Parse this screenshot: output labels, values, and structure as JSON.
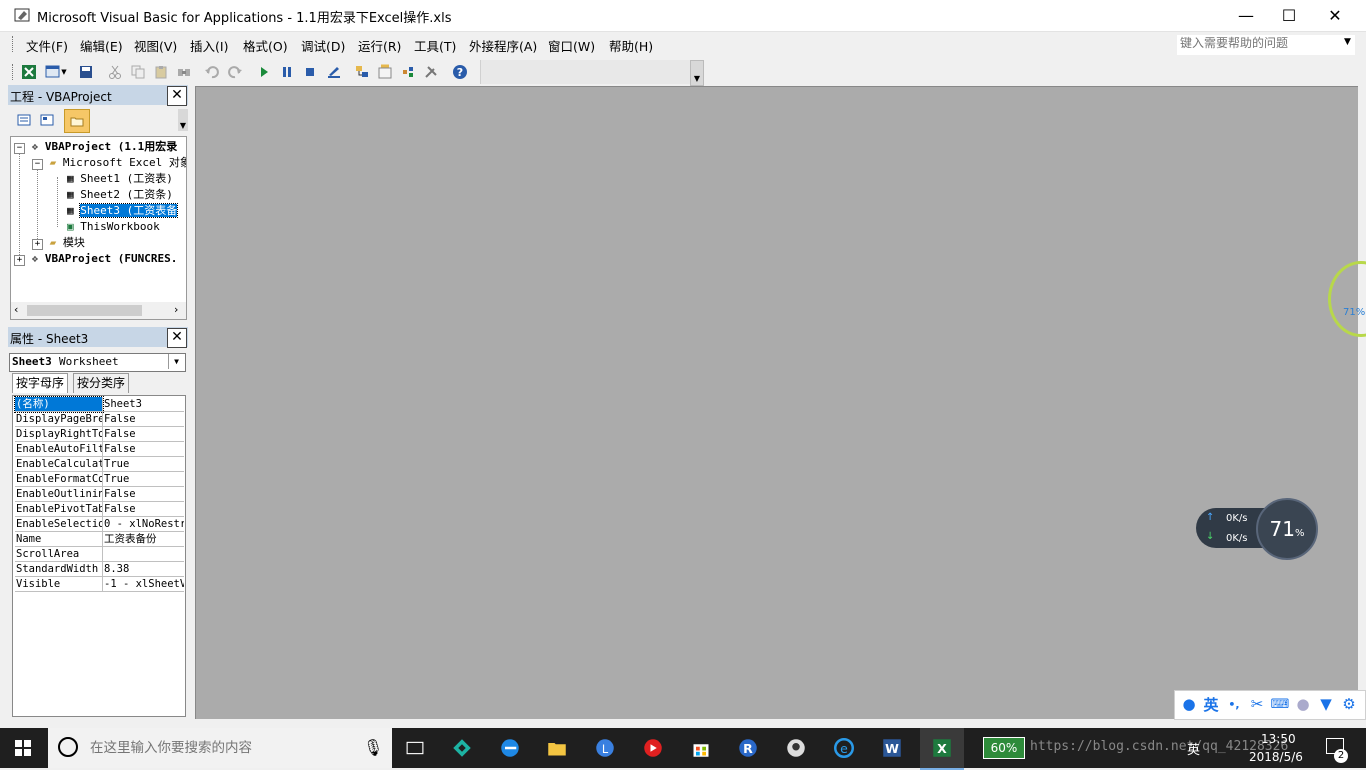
{
  "window": {
    "title": "Microsoft Visual Basic for Applications - 1.1用宏录下Excel操作.xls",
    "minimize": "—",
    "maximize": "☐",
    "close": "✕"
  },
  "menu": {
    "items": [
      "文件(F)",
      "编辑(E)",
      "视图(V)",
      "插入(I)",
      "格式(O)",
      "调试(D)",
      "运行(R)",
      "工具(T)",
      "外接程序(A)",
      "窗口(W)",
      "帮助(H)"
    ],
    "help_placeholder": "键入需要帮助的问题"
  },
  "toolbar": {
    "icons": [
      "excel-icon",
      "insert-userform-icon",
      "save-icon",
      "cut-icon",
      "copy-icon",
      "paste-icon",
      "find-icon",
      "undo-icon",
      "redo-icon",
      "run-icon",
      "break-icon",
      "reset-icon",
      "design-mode-icon",
      "project-explorer-icon",
      "properties-icon",
      "object-browser-icon",
      "toolbox-icon",
      "help-icon"
    ]
  },
  "project": {
    "header": "工程 - VBAProject",
    "tree": [
      {
        "label": "VBAProject (1.1用宏录",
        "bold": true
      },
      {
        "label": "Microsoft Excel 对象"
      },
      {
        "label": "Sheet1 (工资表)"
      },
      {
        "label": "Sheet2 (工资条)"
      },
      {
        "label": "Sheet3 (工资表备",
        "selected": true
      },
      {
        "label": "ThisWorkbook"
      },
      {
        "label": "模块"
      },
      {
        "label": "VBAProject (FUNCRES.",
        "bold": true
      }
    ]
  },
  "properties": {
    "header": "属性 - Sheet3",
    "combo_name": "Sheet3",
    "combo_type": "Worksheet",
    "tabs": [
      "按字母序",
      "按分类序"
    ],
    "rows": [
      {
        "name": "(名称)",
        "value": "Sheet3",
        "selected": true
      },
      {
        "name": "DisplayPageBre",
        "value": "False"
      },
      {
        "name": "DisplayRightTo",
        "value": "False"
      },
      {
        "name": "EnableAutoFilt",
        "value": "False"
      },
      {
        "name": "EnableCalculat",
        "value": "True"
      },
      {
        "name": "EnableFormatCo",
        "value": "True"
      },
      {
        "name": "EnableOutlinin",
        "value": "False"
      },
      {
        "name": "EnablePivotTab",
        "value": "False"
      },
      {
        "name": "EnableSelectio",
        "value": "0 - xlNoRestr"
      },
      {
        "name": "Name",
        "value": "工资表备份"
      },
      {
        "name": "ScrollArea",
        "value": ""
      },
      {
        "name": "StandardWidth",
        "value": "8.38"
      },
      {
        "name": "Visible",
        "value": "-1 - xlSheetV"
      }
    ]
  },
  "widgets": {
    "net_up": "0K/s",
    "net_down": "0K/s",
    "gauge_value": "71",
    "gauge_unit": "%",
    "edge_gauge": "71%"
  },
  "ime": {
    "lang": "英"
  },
  "taskbar": {
    "search_placeholder": "在这里输入你要搜索的内容",
    "battery": "60%",
    "watermark": "https://blog.csdn.net/qq_42128326",
    "ime_lang": "英",
    "time": "13:50",
    "date": "2018/5/6",
    "notify_count": "2"
  },
  "colors": {
    "workspace": "#ababab",
    "panel_header": "#c7d6e6",
    "selection": "#0078d7",
    "taskbar": "#1f1f1f"
  }
}
